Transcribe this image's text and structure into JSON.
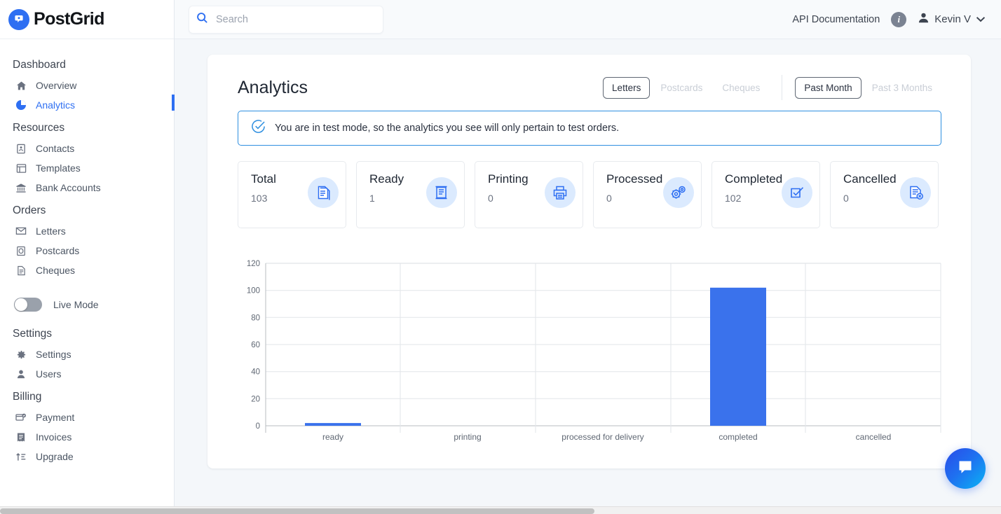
{
  "brand": {
    "name": "PostGrid",
    "accent": "#2e6ff2",
    "logo_icon": "postgrid-logo-icon"
  },
  "sidebar": {
    "sections": [
      {
        "title": "Dashboard",
        "items": [
          {
            "label": "Overview",
            "icon": "home-icon",
            "active": false
          },
          {
            "label": "Analytics",
            "icon": "pie-chart-icon",
            "active": true
          }
        ]
      },
      {
        "title": "Resources",
        "items": [
          {
            "label": "Contacts",
            "icon": "contact-card-icon",
            "active": false
          },
          {
            "label": "Templates",
            "icon": "template-icon",
            "active": false
          },
          {
            "label": "Bank Accounts",
            "icon": "bank-icon",
            "active": false
          }
        ]
      },
      {
        "title": "Orders",
        "items": [
          {
            "label": "Letters",
            "icon": "letter-icon",
            "active": false
          },
          {
            "label": "Postcards",
            "icon": "postcard-icon",
            "active": false
          },
          {
            "label": "Cheques",
            "icon": "cheque-icon",
            "active": false
          }
        ]
      }
    ],
    "live_mode": {
      "label": "Live Mode",
      "enabled": false,
      "icon": "toggle-switch-icon"
    },
    "sections_lower": [
      {
        "title": "Settings",
        "items": [
          {
            "label": "Settings",
            "icon": "gear-icon",
            "active": false
          },
          {
            "label": "Users",
            "icon": "user-icon",
            "active": false
          }
        ]
      },
      {
        "title": "Billing",
        "items": [
          {
            "label": "Payment",
            "icon": "payment-card-icon",
            "active": false
          },
          {
            "label": "Invoices",
            "icon": "invoice-icon",
            "active": false
          },
          {
            "label": "Upgrade",
            "icon": "upgrade-arrow-icon",
            "active": false
          }
        ]
      }
    ]
  },
  "topbar": {
    "search": {
      "value": "",
      "placeholder": "Search",
      "icon": "search-icon"
    },
    "api_documentation": "API Documentation",
    "info_icon": "info-icon",
    "info_glyph": "i",
    "avatar_icon": "user-avatar-icon",
    "user_name": "Kevin V",
    "caret_icon": "chevron-down-icon"
  },
  "panel": {
    "title": "Analytics",
    "product_tabs": [
      {
        "label": "Letters",
        "selected": true
      },
      {
        "label": "Postcards",
        "selected": false
      },
      {
        "label": "Cheques",
        "selected": false
      }
    ],
    "range_tabs": [
      {
        "label": "Past Month",
        "selected": true
      },
      {
        "label": "Past 3 Months",
        "selected": false
      }
    ],
    "banner": {
      "icon": "check-circle-icon",
      "text": "You are in test mode, so the analytics you see will only pertain to test orders.",
      "border_color": "#2e8fe0"
    },
    "stats": [
      {
        "label": "Total",
        "value": "103",
        "icon": "documents-stack-icon"
      },
      {
        "label": "Ready",
        "value": "1",
        "icon": "scroll-document-icon"
      },
      {
        "label": "Printing",
        "value": "0",
        "icon": "printer-icon"
      },
      {
        "label": "Processed",
        "value": "0",
        "icon": "gears-icon"
      },
      {
        "label": "Completed",
        "value": "102",
        "icon": "checked-box-icon"
      },
      {
        "label": "Cancelled",
        "value": "0",
        "icon": "document-cancel-icon"
      }
    ]
  },
  "chart_data": {
    "type": "bar",
    "title": "",
    "xlabel": "",
    "ylabel": "",
    "categories": [
      "ready",
      "printing",
      "processed for delivery",
      "completed",
      "cancelled"
    ],
    "values": [
      1,
      0,
      0,
      102,
      0
    ],
    "series": [
      {
        "name": "Letters",
        "values": [
          1,
          0,
          0,
          102,
          0
        ]
      }
    ],
    "ylim": [
      0,
      120
    ],
    "yticks": [
      0,
      20,
      40,
      60,
      80,
      100,
      120
    ],
    "grid": true,
    "legend": "none",
    "bar_color": "#3a72ec"
  },
  "chat": {
    "icon": "chat-bubble-icon",
    "label": "Open chat"
  },
  "scrollbar": {
    "orientation": "horizontal",
    "icon": "scrollbar-thumb-icon"
  }
}
